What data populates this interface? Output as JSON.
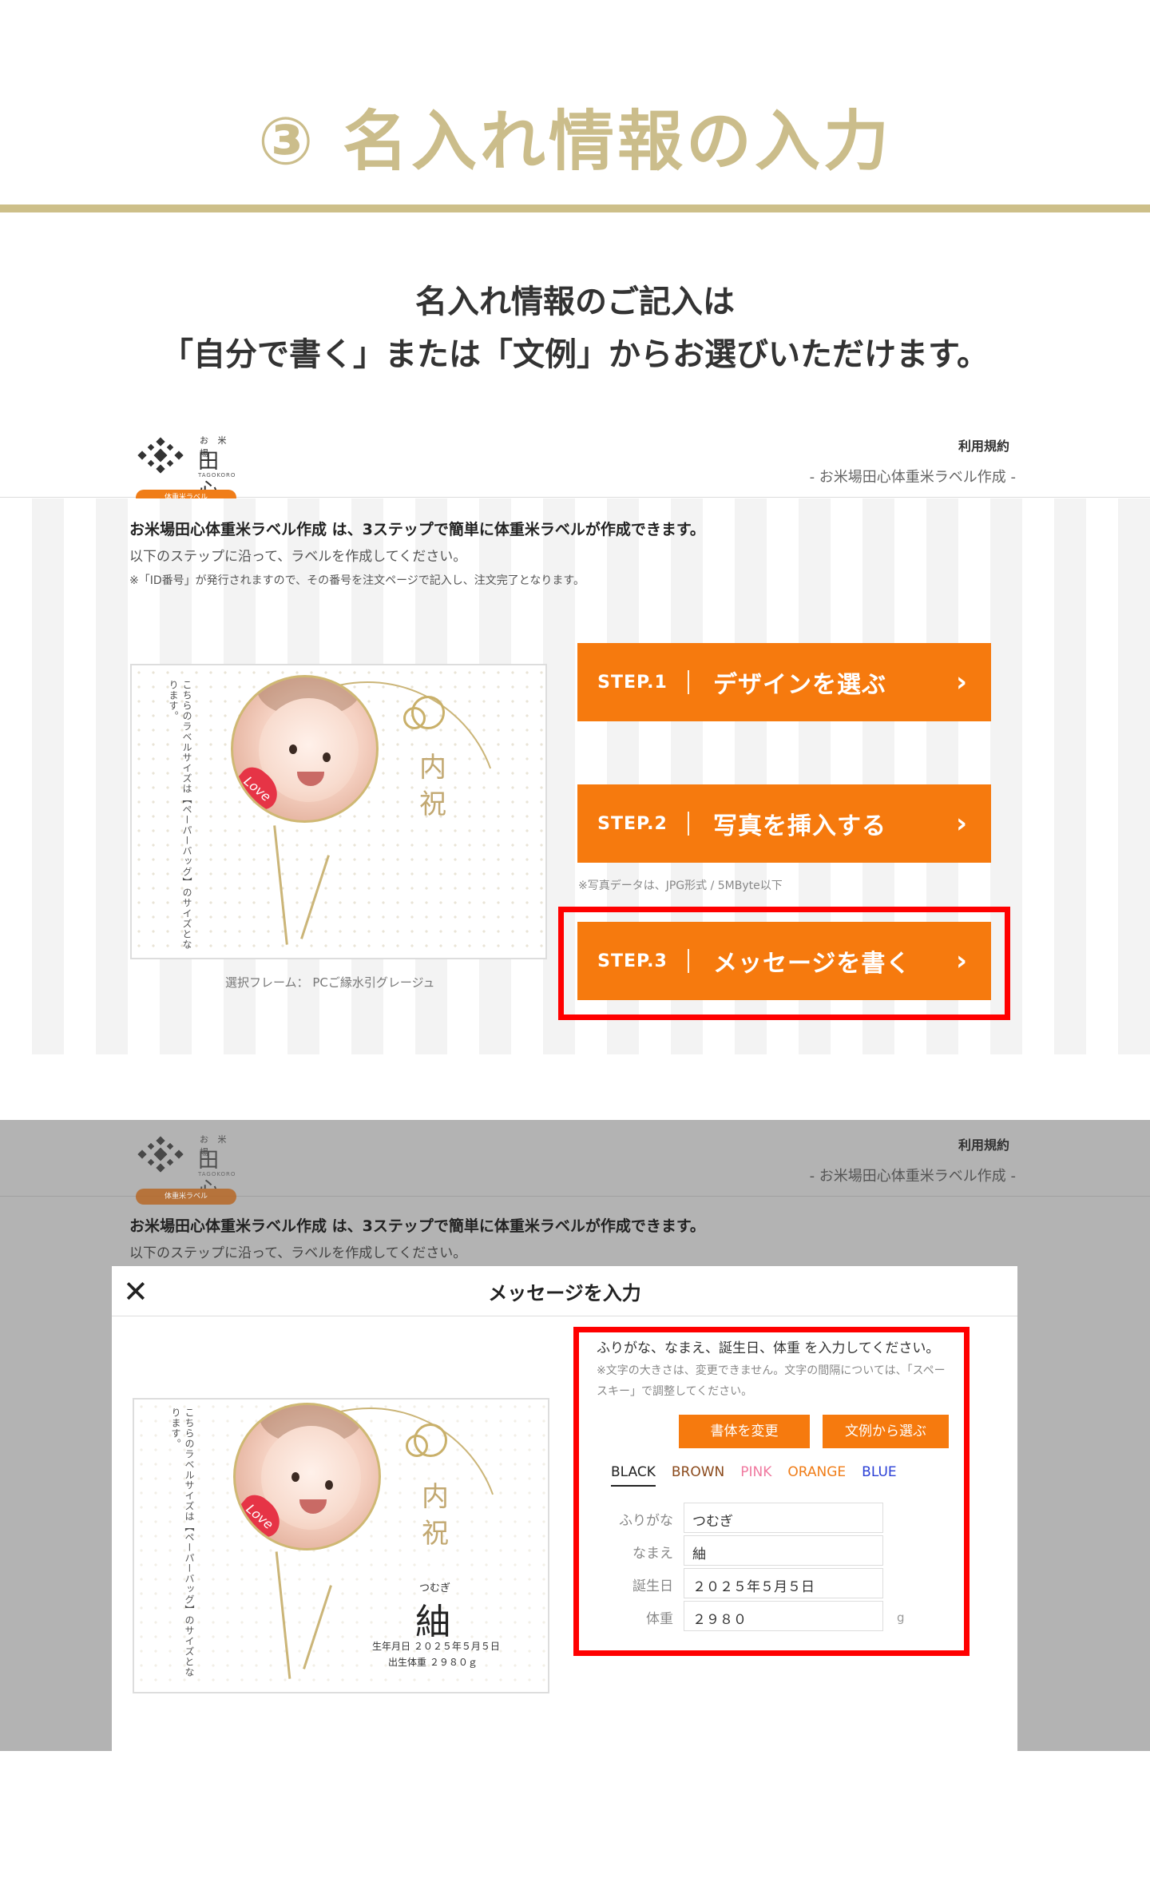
{
  "heading": {
    "title": "③ 名入れ情報の入力",
    "line1": "名入れ情報のご記入は",
    "line2": "「自分で書く」または「文例」からお選びいただけます。"
  },
  "site": {
    "logo_small": "お 米 場",
    "logo_main": "田心",
    "logo_roman": "TAGOKORO",
    "logo_pill": "体重米ラベル",
    "terms": "利用規約",
    "subtitle": "- お米場田心体重米ラベル作成 -",
    "intro1": "お米場田心体重米ラベル作成 は、3ステップで簡単に体重米ラベルが作成できます。",
    "intro2": "以下のステップに沿って、ラベルを作成してください。",
    "intro3": "※「ID番号」が発行されますので、その番号を注文ページで記入し、注文完了となります。"
  },
  "label_preview": {
    "vertical_text": "こちらのラベルサイズは【ペーパーバッグ】のサイズとなります。",
    "pillow_text": "Love",
    "kanji1": "内",
    "kanji2": "祝",
    "frame_caption": "選択フレーム： PCご縁水引グレージュ",
    "furigana": "つむぎ",
    "name": "紬",
    "birth_line": "生年月日 ２０２５年５月５日",
    "weight_line": "出生体重 ２９８０ｇ"
  },
  "steps": [
    {
      "label": "STEP.1",
      "text": "デザインを選ぶ",
      "chevron": "›"
    },
    {
      "label": "STEP.2",
      "text": "写真を挿入する",
      "chevron": "›"
    },
    {
      "label": "STEP.3",
      "text": "メッセージを書く",
      "chevron": "›"
    }
  ],
  "photo_note": "※写真データは、JPG形式 / 5MByte以下",
  "modal": {
    "close": "✕",
    "title": "メッセージを入力",
    "instruction": "ふりがな、なまえ、誕生日、体重 を入力してください。",
    "note": "※文字の大きさは、変更できません。文字の間隔については、「スペースキー」で調整してください。",
    "btn_font": "書体を変更",
    "btn_example": "文例から選ぶ",
    "colors": [
      {
        "label": "BLACK",
        "color": "#222222"
      },
      {
        "label": "BROWN",
        "color": "#8b4a1c"
      },
      {
        "label": "PINK",
        "color": "#f07aa0"
      },
      {
        "label": "ORANGE",
        "color": "#f07d18"
      },
      {
        "label": "BLUE",
        "color": "#2a3fd6"
      }
    ],
    "fields": [
      {
        "label": "ふりがな",
        "value": "つむぎ",
        "unit": ""
      },
      {
        "label": "なまえ",
        "value": "紬",
        "unit": ""
      },
      {
        "label": "誕生日",
        "value": "２０２５年５月５日",
        "unit": ""
      },
      {
        "label": "体重",
        "value": "２９８０",
        "unit": "g"
      }
    ]
  }
}
